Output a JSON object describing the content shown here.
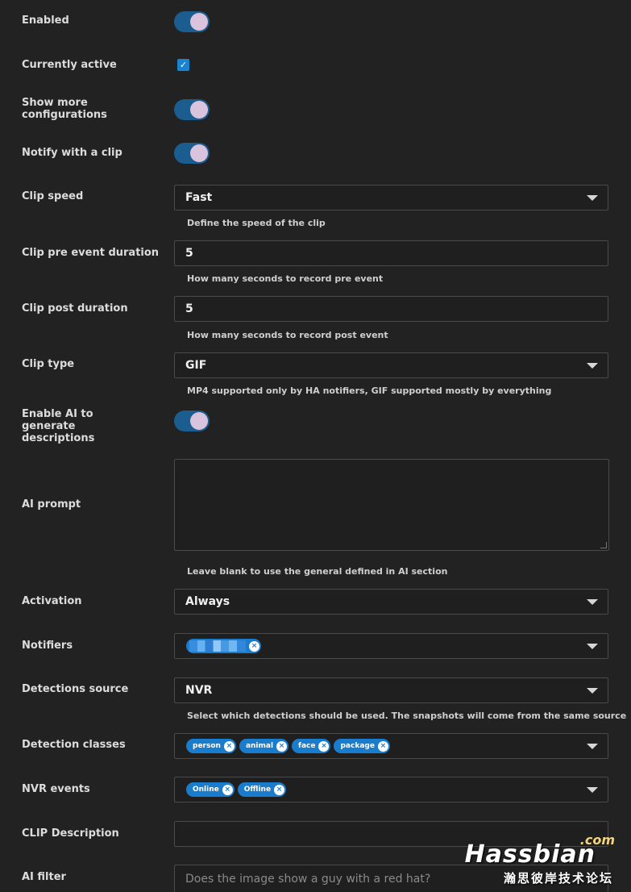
{
  "rows": {
    "enabled": {
      "label": "Enabled"
    },
    "currently_active": {
      "label": "Currently active",
      "check": "✓"
    },
    "show_more": {
      "label": "Show more configurations"
    },
    "notify_clip": {
      "label": "Notify with a clip"
    },
    "clip_speed": {
      "label": "Clip speed",
      "value": "Fast",
      "helper": "Define the speed of the clip"
    },
    "clip_pre": {
      "label": "Clip pre event duration",
      "value": "5",
      "helper": "How many seconds to record pre event"
    },
    "clip_post": {
      "label": "Clip post duration",
      "value": "5",
      "helper": "How many seconds to record post event"
    },
    "clip_type": {
      "label": "Clip type",
      "value": "GIF",
      "helper": "MP4 supported only by HA notifiers, GIF supported mostly by everything"
    },
    "enable_ai": {
      "label": "Enable AI to generate descriptions"
    },
    "ai_prompt": {
      "label": "AI prompt",
      "helper": "Leave blank to use the general defined in AI section"
    },
    "activation": {
      "label": "Activation",
      "value": "Always"
    },
    "notifiers": {
      "label": "Notifiers"
    },
    "detections_source": {
      "label": "Detections source",
      "value": "NVR",
      "helper": "Select which detections should be used. The snapshots will come from the same source"
    },
    "detection_classes": {
      "label": "Detection classes",
      "chips": [
        "person",
        "animal",
        "face",
        "package"
      ]
    },
    "nvr_events": {
      "label": "NVR events",
      "chips": [
        "Online",
        "Offline"
      ]
    },
    "clip_description": {
      "label": "CLIP Description",
      "value": ""
    },
    "ai_filter": {
      "label": "AI filter",
      "placeholder": "Does the image show a guy with a red hat?"
    }
  },
  "chip_remove_glyph": "×",
  "watermark": {
    "com": ".com",
    "main": "Hassbian",
    "cn": "瀚思彼岸技术论坛"
  }
}
